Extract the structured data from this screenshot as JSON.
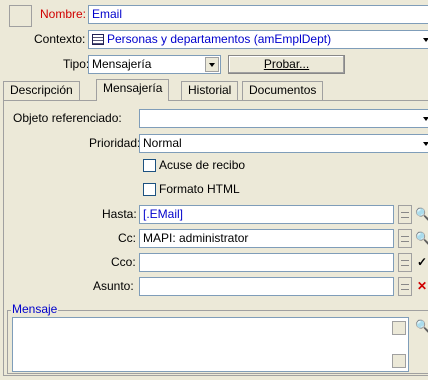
{
  "header": {
    "name_label": "Nombre:",
    "name_value": "Email",
    "context_label": "Contexto:",
    "context_value": "Personas y departamentos (amEmplDept)",
    "type_label": "Tipo:",
    "type_value": "Mensajería",
    "test_button": "Probar..."
  },
  "tabs": [
    {
      "label": "Descripción"
    },
    {
      "label": "Mensajería"
    },
    {
      "label": "Historial"
    },
    {
      "label": "Documentos"
    }
  ],
  "form": {
    "ref_object_label": "Objeto referenciado:",
    "ref_object_value": "",
    "priority_label": "Prioridad:",
    "priority_value": "Normal",
    "receipt_label": "Acuse de recibo",
    "html_label": "Formato HTML",
    "to_label": "Hasta:",
    "to_value": "[.EMail]",
    "cc_label": "Cc:",
    "cc_value": "MAPI: administrator",
    "bcc_label": "Cco:",
    "bcc_value": "",
    "subject_label": "Asunto:",
    "subject_value": "",
    "message_label": "Mensaje",
    "message_value": ""
  },
  "icons": {
    "context": "table-icon",
    "search": "magnifier-icon",
    "check": "checkmark-icon",
    "delete": "x-icon"
  },
  "colors": {
    "label_red": "#d00000",
    "value_blue": "#0000cc",
    "background": "#ece9d8"
  }
}
